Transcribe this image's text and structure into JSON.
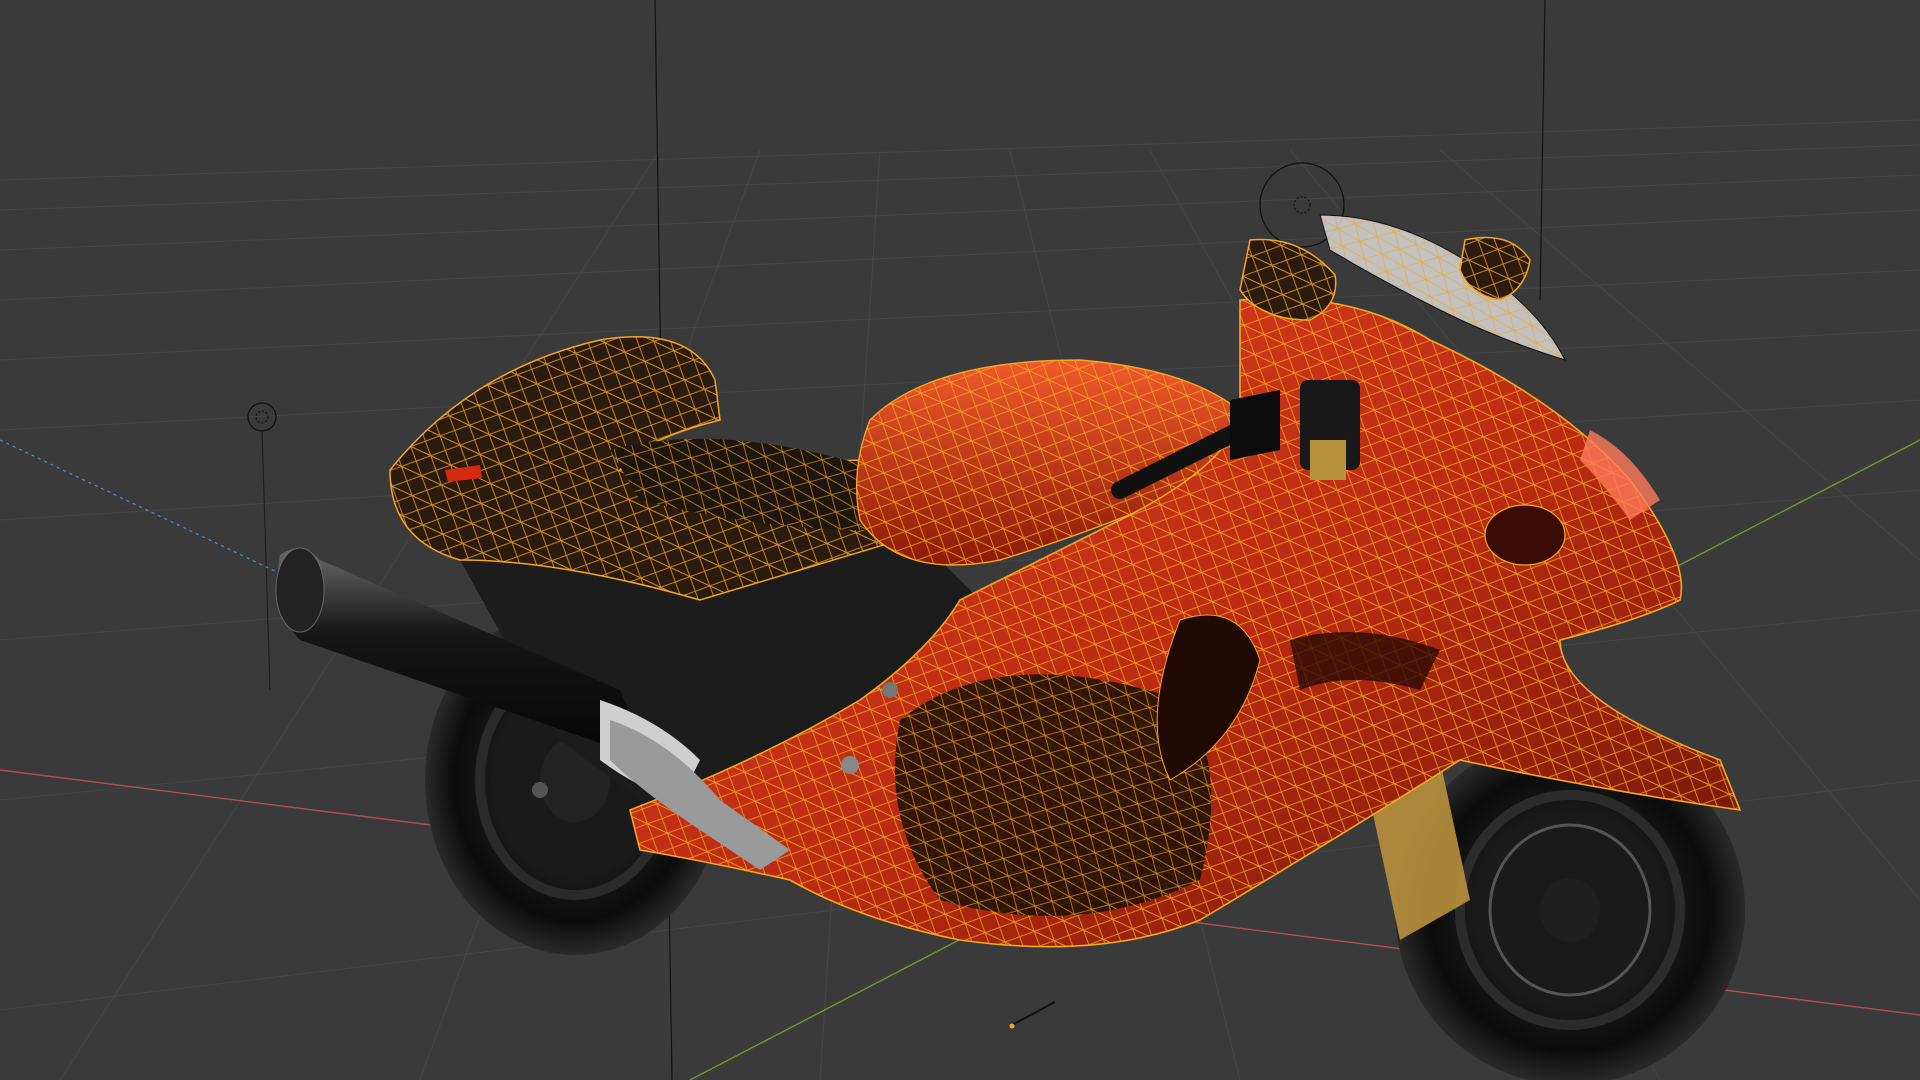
{
  "app": {
    "name": "3D viewport"
  },
  "viewport": {
    "background": "#3a3a3a",
    "grid_color": "#4a4a4a",
    "x_axis_color": "#b34e55",
    "y_axis_color": "#6f9a2c",
    "selection_outline_color": "#f5a623",
    "object_body_color": "#c8321e",
    "object_dark_color": "#141414",
    "light_line_color": "#000000",
    "camera_dashed_line_color": "#4d8fd6"
  },
  "objects": {
    "selected": "motorcycle",
    "light_icon": "sun-lamp-icon",
    "camera_icon": "point-light-icon",
    "origin_marker": "object-origin-icon"
  }
}
